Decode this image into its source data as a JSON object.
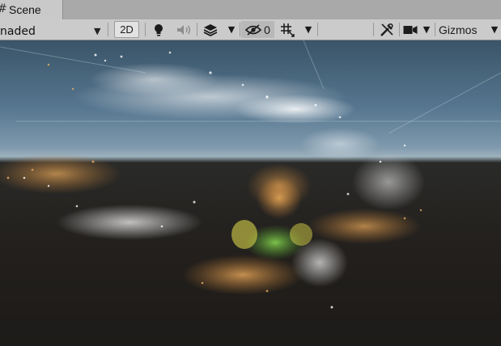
{
  "tab": {
    "label": "Scene",
    "icon": "grid-hash-icon"
  },
  "toolbar": {
    "shading_mode": "naded",
    "btn_2d": "2D",
    "lighting_icon": "lightbulb-icon",
    "audio_icon": "speaker-icon",
    "effects_icon": "layers-icon",
    "hidden_count": "0",
    "gizmos_label": "Gizmos"
  },
  "scene": {
    "description_icon": "point-cloud-render"
  }
}
